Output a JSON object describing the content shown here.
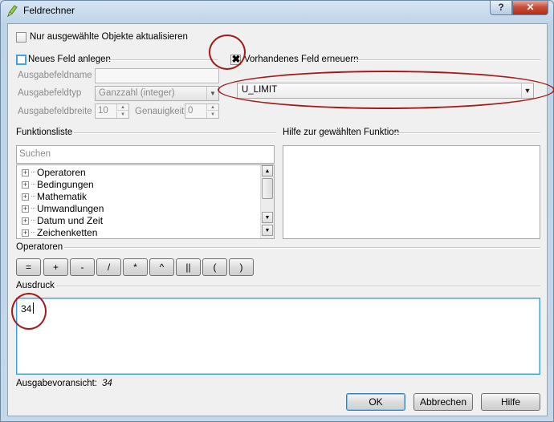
{
  "window": {
    "title": "Feldrechner",
    "help_glyph": "?",
    "close_glyph": "✕"
  },
  "options": {
    "only_selected_label": "Nur ausgewählte Objekte aktualisieren",
    "only_selected_checked": false,
    "new_field_label": "Neues Feld anlegen",
    "new_field_checked": false,
    "existing_field_label": "Vorhandenes Feld erneuern",
    "existing_field_checked": true,
    "check_glyph": "✖"
  },
  "new_field": {
    "name_label": "Ausgabefeldname",
    "name_value": "",
    "type_label": "Ausgabefeldtyp",
    "type_value": "Ganzzahl (integer)",
    "width_label": "Ausgabefeldbreite",
    "width_value": "10",
    "precision_label": "Genauigkeit",
    "precision_value": "0"
  },
  "existing_field": {
    "selected": "U_LIMIT"
  },
  "functions": {
    "list_label": "Funktionsliste",
    "help_label": "Hilfe zur gewählten Funktion",
    "search_placeholder": "Suchen",
    "items": [
      "Operatoren",
      "Bedingungen",
      "Mathematik",
      "Umwandlungen",
      "Datum und Zeit",
      "Zeichenketten"
    ]
  },
  "operators": {
    "label": "Operatoren",
    "buttons": [
      "=",
      "+",
      "-",
      "/",
      "*",
      "^",
      "||",
      "(",
      ")"
    ]
  },
  "expression": {
    "label": "Ausdruck",
    "value": "34"
  },
  "preview": {
    "label": "Ausgabevoransicht:",
    "value": "34"
  },
  "buttons": {
    "ok": "OK",
    "cancel": "Abbrechen",
    "help": "Hilfe"
  },
  "colors": {
    "annotation": "#a51a1a",
    "focus": "#4a9fe0"
  }
}
